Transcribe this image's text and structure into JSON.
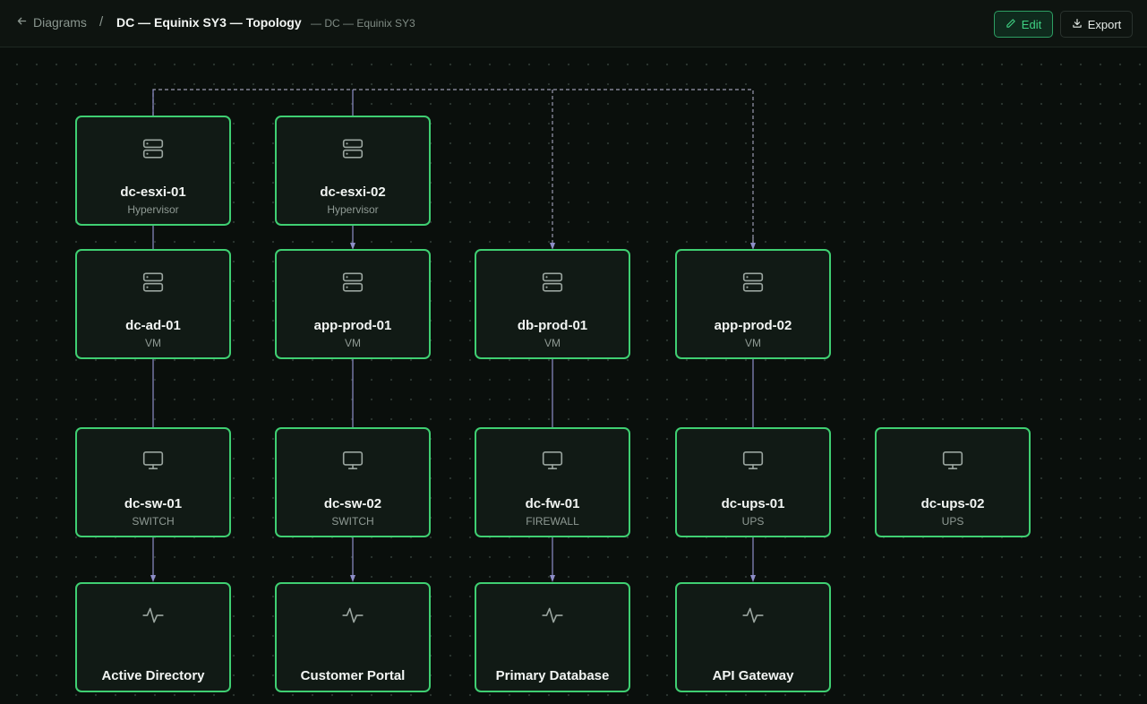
{
  "header": {
    "back_label": "Diagrams",
    "separator": "/",
    "title": "DC — Equinix SY3 — Topology",
    "subtitle": "— DC — Equinix SY3",
    "edit_label": "Edit",
    "export_label": "Export"
  },
  "colors": {
    "accent": "#3fcf72",
    "edge": "#8e8ec9",
    "node_bg": "#111a15"
  },
  "nodes": {
    "esxi01": {
      "name": "dc-esxi-01",
      "kind": "Hypervisor",
      "icon": "server-icon"
    },
    "esxi02": {
      "name": "dc-esxi-02",
      "kind": "Hypervisor",
      "icon": "server-icon"
    },
    "ad01": {
      "name": "dc-ad-01",
      "kind": "VM",
      "icon": "server-icon"
    },
    "appprod01": {
      "name": "app-prod-01",
      "kind": "VM",
      "icon": "server-icon"
    },
    "dbprod01": {
      "name": "db-prod-01",
      "kind": "VM",
      "icon": "server-icon"
    },
    "appprod02": {
      "name": "app-prod-02",
      "kind": "VM",
      "icon": "server-icon"
    },
    "sw01": {
      "name": "dc-sw-01",
      "kind": "SWITCH",
      "icon": "monitor-icon"
    },
    "sw02": {
      "name": "dc-sw-02",
      "kind": "SWITCH",
      "icon": "monitor-icon"
    },
    "fw01": {
      "name": "dc-fw-01",
      "kind": "FIREWALL",
      "icon": "monitor-icon"
    },
    "ups01": {
      "name": "dc-ups-01",
      "kind": "UPS",
      "icon": "monitor-icon"
    },
    "ups02": {
      "name": "dc-ups-02",
      "kind": "UPS",
      "icon": "monitor-icon"
    },
    "svc_ad": {
      "name": "Active Directory",
      "icon": "activity-icon"
    },
    "svc_portal": {
      "name": "Customer Portal",
      "icon": "activity-icon"
    },
    "svc_db": {
      "name": "Primary Database",
      "icon": "activity-icon"
    },
    "svc_api": {
      "name": "API Gateway",
      "icon": "activity-icon"
    }
  }
}
